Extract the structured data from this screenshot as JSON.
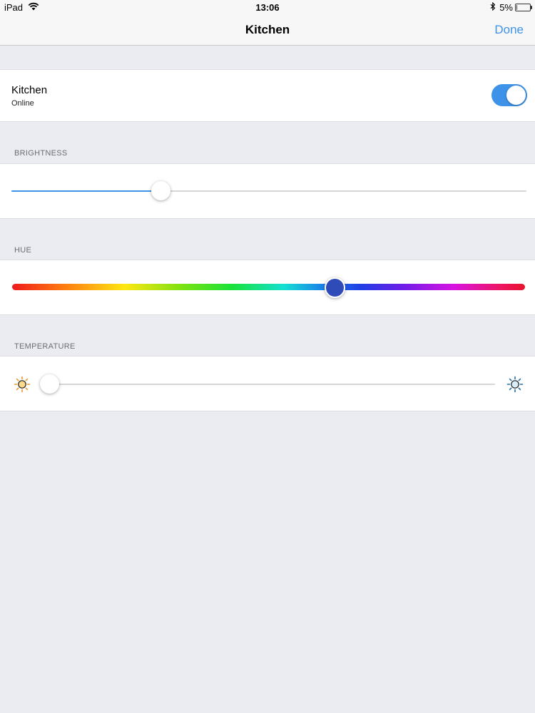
{
  "status_bar": {
    "device": "iPad",
    "time": "13:06",
    "battery": "5%",
    "battery_level": 0.05,
    "icons": [
      "wifi-icon",
      "bluetooth-icon",
      "battery-icon"
    ]
  },
  "nav": {
    "title": "Kitchen",
    "done_label": "Done"
  },
  "light": {
    "name": "Kitchen",
    "status": "Online",
    "on": true,
    "toggle_color": "#3e93e8"
  },
  "sections": {
    "brightness": "BRIGHTNESS",
    "hue": "HUE",
    "temperature": "TEMPERATURE"
  },
  "controls": {
    "brightness_level": 0.29,
    "hue_level": 0.63,
    "hue_thumb_color": "#2e4bb8",
    "temperature_level": 0.0,
    "warm_icon": "sun-warm-icon",
    "cool_icon": "sun-cool-icon",
    "warm_color": "#e89b2a",
    "cool_color": "#1f6fa8"
  }
}
